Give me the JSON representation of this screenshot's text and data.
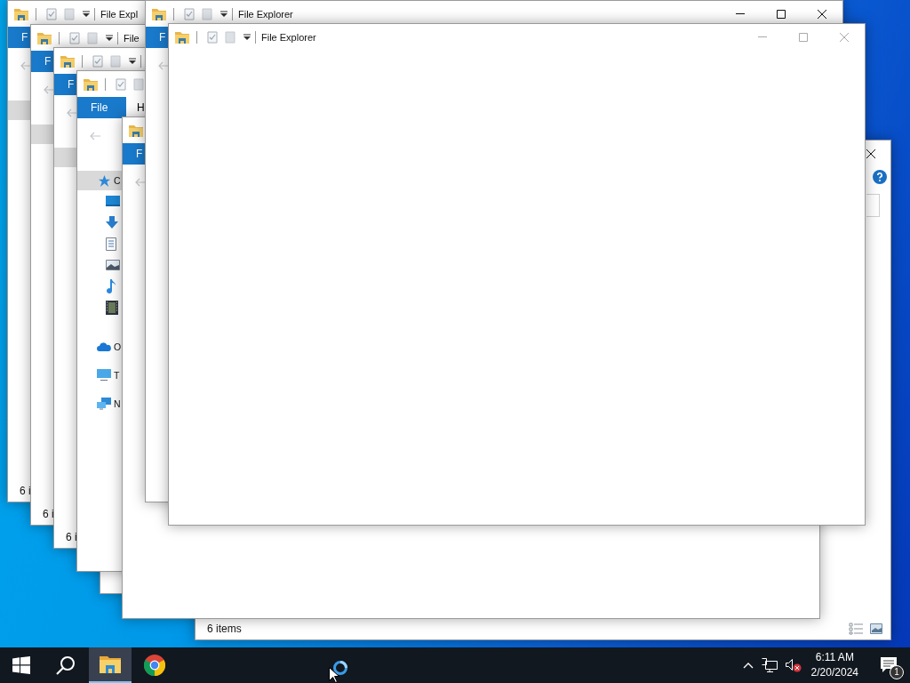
{
  "desktop": {
    "windows": [
      {
        "kind": "explorer",
        "controls": [
          {
            "kind": "close"
          }
        ],
        "active": true,
        "help": true,
        "search_box": true,
        "status": "6 items",
        "view_buttons": true
      },
      {
        "kind": "explorer",
        "title": "File Expl",
        "file_tab": "F",
        "nav": [
          {
            "selected": true
          }
        ],
        "status": "6 i"
      },
      {
        "kind": "explorer",
        "title": "File",
        "file_tab": "F",
        "nav": [
          {
            "selected": true
          }
        ],
        "status": "6 i"
      },
      {
        "kind": "explorer",
        "file_tab": "F",
        "nav": [
          {
            "selected": true
          }
        ],
        "status": "6 i"
      },
      {
        "kind": "blank"
      },
      {
        "kind": "explorer",
        "file_tab": "File",
        "tabs": [
          "H"
        ],
        "nav": [
          {
            "kind": "quick-access",
            "label": "C",
            "selected": true,
            "children": [
              {
                "kind": "desktop",
                "selected": false
              },
              {
                "kind": "downloads",
                "selected": false
              },
              {
                "kind": "documents",
                "selected": false
              },
              {
                "kind": "pictures",
                "selected": false
              },
              {
                "kind": "music",
                "selected": false
              },
              {
                "kind": "videos",
                "selected": false
              }
            ]
          },
          {
            "kind": "onedrive",
            "label": "O",
            "selected": false
          },
          {
            "kind": "this-pc",
            "label": "T",
            "selected": false
          },
          {
            "kind": "network",
            "label": "N",
            "selected": false
          }
        ]
      },
      {
        "kind": "explorer",
        "file_tab": "F"
      },
      {
        "kind": "explorer",
        "title": "File Explorer",
        "controls": [
          {
            "kind": "minimize"
          },
          {
            "kind": "maximize"
          },
          {
            "kind": "close"
          }
        ],
        "active": true,
        "file_tab": "F"
      },
      {
        "kind": "explorer",
        "title": "File Explorer",
        "controls": [
          {
            "kind": "minimize"
          },
          {
            "kind": "maximize"
          },
          {
            "kind": "close"
          }
        ],
        "active": false
      }
    ]
  },
  "taskbar": {
    "apps": [
      {
        "kind": "start",
        "active": false
      },
      {
        "kind": "search",
        "active": false
      },
      {
        "kind": "explorer",
        "active": true
      },
      {
        "kind": "chrome",
        "active": false
      }
    ],
    "busy_indicator": true,
    "tray": {
      "muted": true,
      "time": "6:11 AM",
      "date": "2/20/2024",
      "notifications": "1"
    }
  }
}
